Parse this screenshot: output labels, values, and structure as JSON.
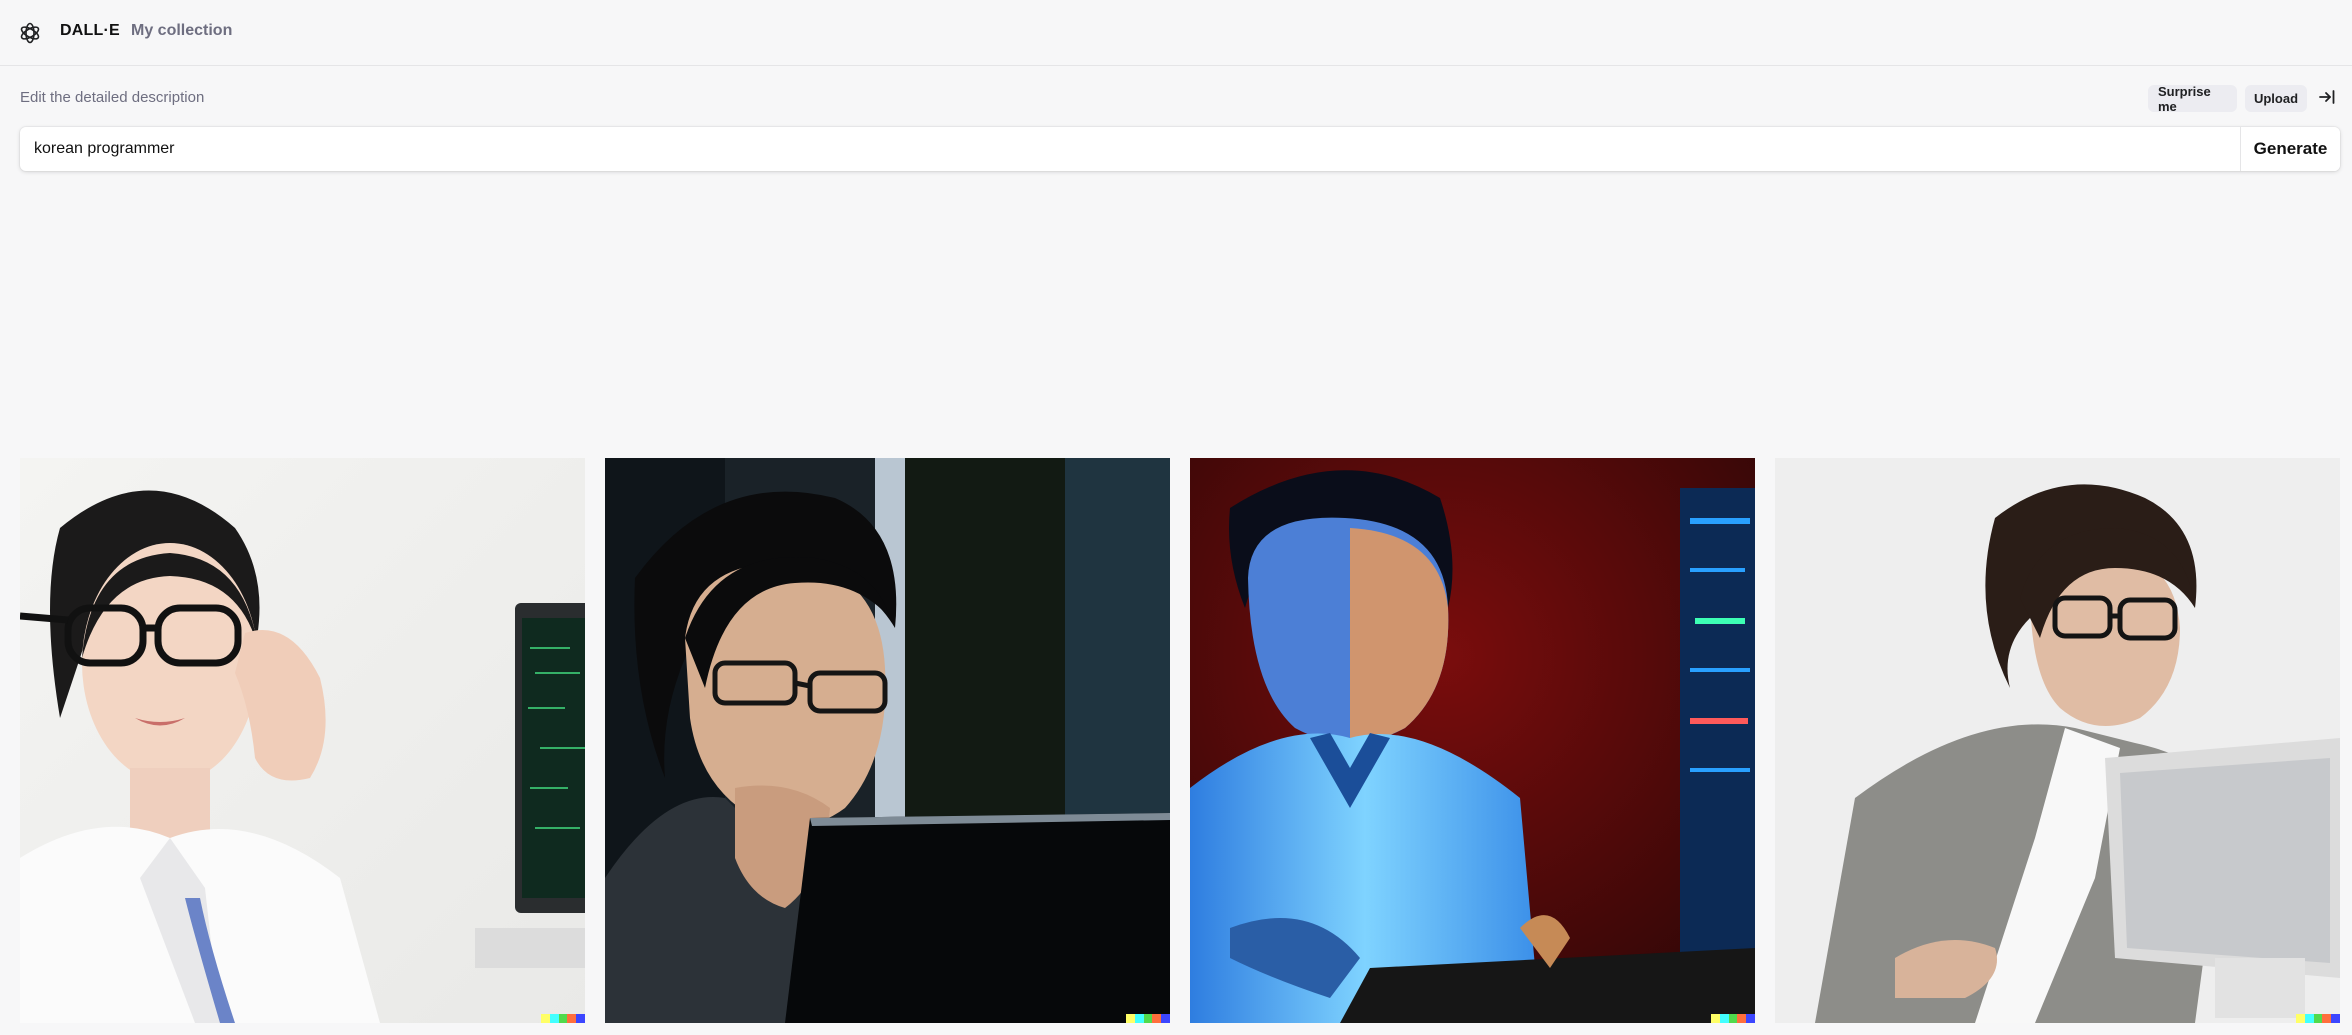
{
  "header": {
    "brand": "DALL·E",
    "nav_collection": "My collection"
  },
  "editor": {
    "label": "Edit the detailed description",
    "surprise_label": "Surprise me",
    "upload_label": "Upload",
    "prompt_value": "korean programmer",
    "generate_label": "Generate"
  },
  "signature_colors": [
    "#ffff66",
    "#42ffff",
    "#51da4c",
    "#ff6e3c",
    "#3c46ff"
  ],
  "results": [
    {
      "subject": "woman with glasses in white shirt next to monitor"
    },
    {
      "subject": "young man with glasses resting chin on hand behind laptop"
    },
    {
      "subject": "man in blue-lit white shirt at keyboard with server rack"
    },
    {
      "subject": "man with glasses in grey cardigan leaning over computer"
    }
  ]
}
